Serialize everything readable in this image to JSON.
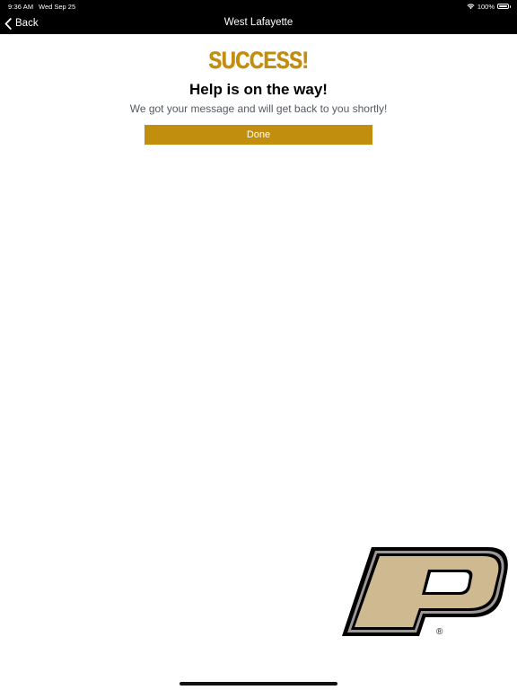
{
  "status_bar": {
    "time": "9:36 AM",
    "date": "Wed Sep 25",
    "battery_percent": "100%",
    "battery_level": 1.0,
    "icons": [
      "wifi-icon",
      "battery-icon"
    ]
  },
  "nav": {
    "back_label": "Back",
    "back_icon": "chevron-left-icon",
    "title": "West Lafayette"
  },
  "main": {
    "success_label": "SUCCESS!",
    "heading": "Help is on the way!",
    "message": "We got your message and will get back to you shortly!",
    "done_label": "Done"
  },
  "logo": {
    "name": "purdue-p-logo",
    "registered_mark": "®"
  },
  "colors": {
    "brand_gold": "#c28e0e",
    "logo_fill": "#cfb991",
    "logo_outline": "#000000",
    "nav_background": "#000000"
  }
}
